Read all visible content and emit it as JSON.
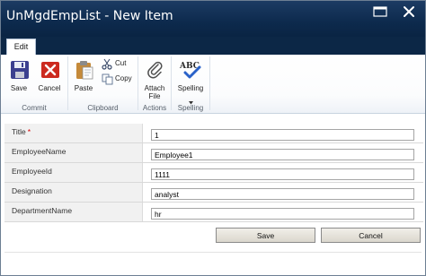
{
  "window": {
    "title": "UnMgdEmpList - New Item",
    "maximize_icon": "maximize-icon",
    "close_icon": "close-icon"
  },
  "ribbon": {
    "tabs": [
      {
        "label": "Edit",
        "active": true
      }
    ],
    "groups": [
      {
        "label": "Commit",
        "buttons": [
          {
            "label": "Save",
            "icon": "floppy-disk-icon"
          },
          {
            "label": "Cancel",
            "icon": "cancel-icon"
          }
        ]
      },
      {
        "label": "Clipboard",
        "buttons": [
          {
            "label": "Paste",
            "icon": "clipboard-icon"
          },
          {
            "label": "Cut",
            "icon": "scissors-icon"
          },
          {
            "label": "Copy",
            "icon": "copy-icon"
          }
        ]
      },
      {
        "label": "Actions",
        "buttons": [
          {
            "label_line1": "Attach",
            "label_line2": "File",
            "icon": "paperclip-icon"
          }
        ]
      },
      {
        "label": "Spelling",
        "buttons": [
          {
            "label": "Spelling",
            "icon": "abc-check-icon"
          }
        ]
      }
    ]
  },
  "form": {
    "fields": [
      {
        "label": "Title",
        "required": "*",
        "value": "1"
      },
      {
        "label": "EmployeeName",
        "value": "Employee1"
      },
      {
        "label": "EmployeeId",
        "value": "1111"
      },
      {
        "label": "Designation",
        "value": "analyst"
      },
      {
        "label": "DepartmentName",
        "value": "hr"
      }
    ],
    "save_label": "Save",
    "cancel_label": "Cancel"
  },
  "colors": {
    "title_bar": "#0d2a4d",
    "required_star": "#d40000",
    "button_face": "#e6e3da"
  }
}
